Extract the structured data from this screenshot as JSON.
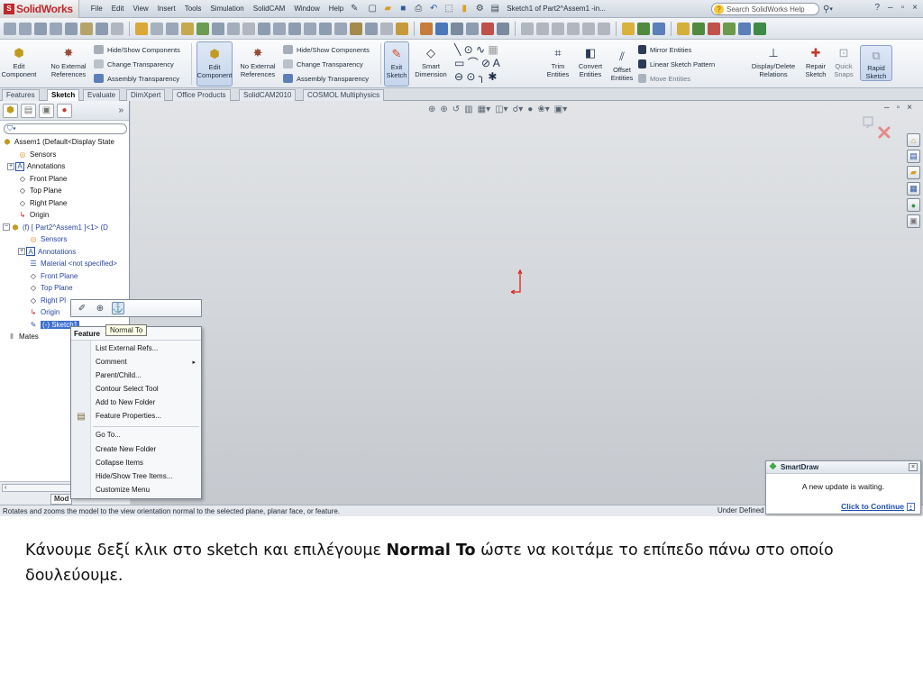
{
  "app": {
    "logo_text": "SolidWorks",
    "document_title": "Sketch1 of Part2^Assem1 -in..."
  },
  "menu": [
    "File",
    "Edit",
    "View",
    "Insert",
    "Tools",
    "Simulation",
    "SolidCAM",
    "Window",
    "Help"
  ],
  "search": {
    "placeholder": "Search SolidWorks Help"
  },
  "command_manager": {
    "edit_component_1": "Edit Component",
    "no_external_refs": "No External References",
    "hide_show_1": "Hide/Show Components",
    "change_transparency_1": "Change Transparency",
    "assembly_transparency_1": "Assembly Transparency",
    "edit_component_2": "Edit Component",
    "no_external_refs_2": "No External References",
    "hide_show_2": "Hide/Show Components",
    "change_transparency_2": "Change Transparency",
    "assembly_transparency_2": "Assembly Transparency",
    "exit_sketch": "Exit Sketch",
    "smart_dimension": "Smart Dimension",
    "trim_entities": "Trim Entities",
    "convert_entities": "Convert Entities",
    "offset_entities": "Offset Entities",
    "mirror_entities": "Mirror Entities",
    "linear_sketch_pattern": "Linear Sketch Pattern",
    "move_entities": "Move Entities",
    "display_delete_relations": "Display/Delete Relations",
    "repair_sketch": "Repair Sketch",
    "quick_snaps": "Quick Snaps",
    "rapid_sketch": "Rapid Sketch"
  },
  "tabs": [
    "Features",
    "Sketch",
    "Evaluate",
    "DimXpert",
    "Office Products",
    "SolidCAM2010",
    "COSMOL Multiphysics"
  ],
  "active_tab": "Sketch",
  "tree": {
    "root": "Assem1  (Default<Display State",
    "items": [
      "Sensors",
      "Annotations",
      "Front Plane",
      "Top Plane",
      "Right Plane",
      "Origin",
      "(f) [ Part2^Assem1 ]<1> (D",
      "Sensors",
      "Annotations",
      "Material <not specified>",
      "Front Plane",
      "Top Plane",
      "Right Pl",
      "Origin",
      "(-) Sketch1",
      "Mates"
    ],
    "bottom_tab": "Mod"
  },
  "tooltip": "Normal To",
  "context_menu": {
    "header": "Feature",
    "items": [
      "List External Refs...",
      "Comment",
      "Parent/Child...",
      "Contour Select Tool",
      "Add to New Folder",
      "Feature Properties...",
      "Go To...",
      "Create New Folder",
      "Collapse Items",
      "Hide/Show Tree Items...",
      "Customize Menu"
    ]
  },
  "status": {
    "hint": "Rotates and zooms the model to the view orientation normal to the selected plane, planar face, or feature.",
    "state": "Under Defined"
  },
  "smartdraw": {
    "title": "SmartDraw",
    "message": "A new update is waiting.",
    "link": "Click to Continue"
  },
  "caption": {
    "before": "Κάνουμε δεξί κλικ στο sketch και επιλέγουμε ",
    "bold": "Normal To",
    "after": " ώστε να κοιτάμε το επίπεδο πάνω στο οποίο δουλεύουμε."
  },
  "colors": {
    "accent": "#c2272d",
    "link": "#1d4fb0",
    "sketch_red": "#e02020"
  }
}
